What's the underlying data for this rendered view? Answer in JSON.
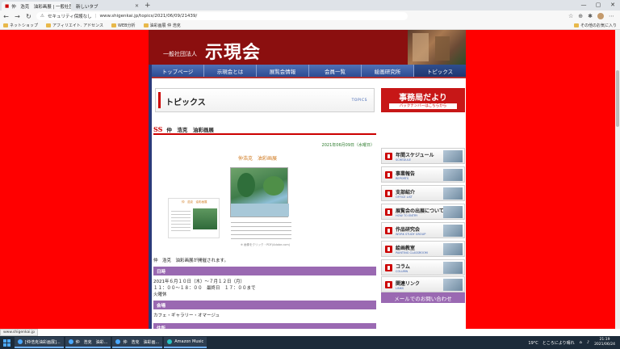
{
  "browser": {
    "tabs": [
      {
        "label": "仲　浩克　油彩画展 | 一般社団..."
      },
      {
        "label": "新しいタブ"
      }
    ],
    "new_tab": "+",
    "window_controls": [
      "—",
      "▢",
      "✕"
    ],
    "address": {
      "security": "セキュリティ保護なし",
      "url": "www.shigenkai.jp/topics/2021/06/09/21439/"
    },
    "nav_icons": {
      "back": "←",
      "forward": "→",
      "reload": "↻"
    },
    "tool_icons": [
      "☆",
      "⊕",
      "✱",
      "⋯"
    ],
    "favorites": [
      {
        "label": "ネットショップ"
      },
      {
        "label": "アフィリエイト. アドセンス"
      },
      {
        "label": "WEB分析"
      },
      {
        "label": "油彩画展 仲 浩克"
      }
    ],
    "favorites_right": "その他のお気に入り"
  },
  "site": {
    "org": "一般社団法人",
    "name": "示現会",
    "nav": [
      {
        "label": "トップページ"
      },
      {
        "label": "示現会とは"
      },
      {
        "label": "展覧会情報"
      },
      {
        "label": "会員一覧"
      },
      {
        "label": "絵画研究所"
      },
      {
        "label": "トピックス"
      }
    ]
  },
  "main": {
    "heading": "トピックス",
    "heading_en": "TOPICS",
    "post_mark": "SS",
    "post_title": "仲　浩克　油彩画展",
    "date": "2021年06月09日（水曜日）",
    "flyer_title": "仲浩克　油彩画展",
    "flyer_small_title": "仲　浩克　油彩画展",
    "flyer_caption": "※ 画像をクリック・PDF(Adobe.com)",
    "lead": "仲　浩克　油彩画展が開催されます。",
    "sections": [
      {
        "label": "日時",
        "lines": [
          "2021年６月１０日（木）～７月１２日（月）",
          "１１：００～１８：００　最終日　１７：００まで",
          "火曜休"
        ]
      },
      {
        "label": "会場",
        "lines": [
          "カフェ・ギャラリー・オマージュ"
        ]
      },
      {
        "label": "住所",
        "lines": []
      }
    ]
  },
  "sidebar": {
    "jimu_title": "事務局だより",
    "jimu_sub": "バックナンバーはこちらから",
    "menu": [
      {
        "jp": "年間スケジュール",
        "en": "SCHEDULE"
      },
      {
        "jp": "事業報告",
        "en": "REPORTS"
      },
      {
        "jp": "支部紹介",
        "en": "OFFICE LIST"
      },
      {
        "jp": "展覧会の出展について",
        "en": "HOW TO ENTRY"
      },
      {
        "jp": "作品研究会",
        "en": "WORK STUDY GROUP"
      },
      {
        "jp": "絵画教室",
        "en": "PAINTING CLASSROOM"
      },
      {
        "jp": "コラム",
        "en": "COLUMN"
      },
      {
        "jp": "関連リンク",
        "en": "LINKS"
      }
    ],
    "mail": "メールでのお問い合わせ"
  },
  "status_bar": "www.shigenkai.jp",
  "taskbar": {
    "tasks": [
      {
        "label": "[仲浩克油彩画展]..."
      },
      {
        "label": "仲　浩克　油彩..."
      },
      {
        "label": "仲　浩克　油彩画..."
      },
      {
        "label": "Amazon Music"
      }
    ],
    "weather": "19°C　ところにより晴れ",
    "time": "21:19",
    "date": "2021/06/24"
  },
  "colors": {
    "page_bg": "#ff0000",
    "banner": "#8b0f0f",
    "nav": "#2c4c92",
    "section": "#9a69b2",
    "accent": "#cc0000"
  }
}
